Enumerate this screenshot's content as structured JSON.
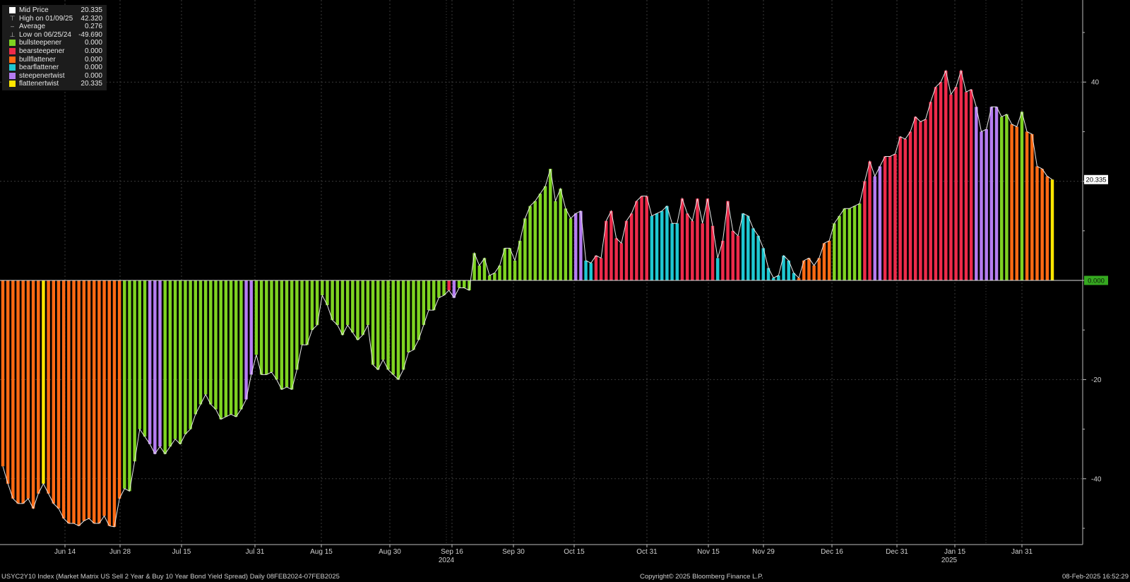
{
  "legend": {
    "rows": [
      {
        "label": "Mid Price",
        "value": "20.335",
        "icon": "white-square-icon",
        "color": "#ffffff"
      },
      {
        "label": "High on 01/09/25",
        "value": "42.320",
        "icon": "high-marker-icon",
        "color": ""
      },
      {
        "label": "Average",
        "value": "0.276",
        "icon": "average-line-icon",
        "color": ""
      },
      {
        "label": "Low on 06/25/24",
        "value": "-49.690",
        "icon": "low-marker-icon",
        "color": ""
      },
      {
        "label": "bullsteepener",
        "value": "0.000",
        "icon": "swatch-icon",
        "color": "#7ed321"
      },
      {
        "label": "bearsteepener",
        "value": "0.000",
        "icon": "swatch-icon",
        "color": "#ee2a4a"
      },
      {
        "label": "bullflattener",
        "value": "0.000",
        "icon": "swatch-icon",
        "color": "#ff6a13"
      },
      {
        "label": "bearflattener",
        "value": "0.000",
        "icon": "swatch-icon",
        "color": "#1ec8d2"
      },
      {
        "label": "steepenertwist",
        "value": "0.000",
        "icon": "swatch-icon",
        "color": "#b57cf2"
      },
      {
        "label": "flattenertwist",
        "value": "20.335",
        "icon": "swatch-icon",
        "color": "#ffe600"
      }
    ]
  },
  "footer": {
    "description": "USYC2Y10 Index (Market Matrix US Sell 2 Year & Buy 10 Year Bond Yield Spread)  Daily 08FEB2024-07FEB2025",
    "copyright": "Copyright© 2025 Bloomberg Finance L.P.",
    "timestamp": "08-Feb-2025 16:52:29"
  },
  "chart_data": {
    "type": "bar",
    "ylim": [
      -50,
      50
    ],
    "yticks": [
      "40",
      "20",
      "-20",
      "-40"
    ],
    "last_value_label": "20.335",
    "zero_label": "0.000",
    "zero_label_color": "#35a820",
    "grid": true,
    "legend_position": "top-left",
    "xtick_labels": [
      "Jun 14",
      "Jun 28",
      "Jul 15",
      "Jul 31",
      "Aug 15",
      "Aug 30",
      "Sep 16",
      "Sep 30",
      "Oct 15",
      "Oct 31",
      "Nov 15",
      "Nov 29",
      "Dec 16",
      "Dec 31",
      "Jan 15",
      "Jan 31"
    ],
    "year_labels": [
      {
        "label": "2024",
        "below": "Sep 16"
      },
      {
        "label": "2025",
        "below": "Jan 15"
      }
    ],
    "regime_colors": {
      "bullsteepener": "#7ed321",
      "bearsteepener": "#ee2a4a",
      "bullflattener": "#ff6a13",
      "bearflattener": "#1ec8d2",
      "steepenertwist": "#b57cf2",
      "flattenertwist": "#ffe600"
    },
    "series": [
      {
        "name": "Mid Price",
        "regime_key": [
          "bullsteepener",
          "bearsteepener",
          "bullflattener",
          "bearflattener",
          "steepenertwist",
          "flattenertwist"
        ],
        "points": [
          [
            -37.5,
            2
          ],
          [
            -41.0,
            2
          ],
          [
            -44.0,
            2
          ],
          [
            -45.0,
            2
          ],
          [
            -45.0,
            2
          ],
          [
            -44.0,
            2
          ],
          [
            -46.0,
            2
          ],
          [
            -43.0,
            2
          ],
          [
            -41.0,
            5
          ],
          [
            -43.0,
            2
          ],
          [
            -45.0,
            2
          ],
          [
            -46.0,
            2
          ],
          [
            -48.0,
            2
          ],
          [
            -49.0,
            2
          ],
          [
            -49.0,
            2
          ],
          [
            -49.5,
            2
          ],
          [
            -48.5,
            2
          ],
          [
            -48.0,
            2
          ],
          [
            -49.0,
            2
          ],
          [
            -49.0,
            2
          ],
          [
            -47.5,
            2
          ],
          [
            -49.5,
            2
          ],
          [
            -49.7,
            2
          ],
          [
            -44.0,
            2
          ],
          [
            -42.0,
            0
          ],
          [
            -42.5,
            0
          ],
          [
            -36.5,
            0
          ],
          [
            -30.0,
            0
          ],
          [
            -31.5,
            0
          ],
          [
            -33.0,
            4
          ],
          [
            -35.0,
            4
          ],
          [
            -33.5,
            4
          ],
          [
            -35.0,
            0
          ],
          [
            -33.5,
            0
          ],
          [
            -32.0,
            0
          ],
          [
            -33.0,
            0
          ],
          [
            -31.0,
            0
          ],
          [
            -30.0,
            0
          ],
          [
            -27.0,
            0
          ],
          [
            -25.0,
            0
          ],
          [
            -23.0,
            0
          ],
          [
            -25.0,
            0
          ],
          [
            -26.0,
            0
          ],
          [
            -28.0,
            0
          ],
          [
            -27.5,
            0
          ],
          [
            -27.0,
            0
          ],
          [
            -27.5,
            0
          ],
          [
            -26.0,
            0
          ],
          [
            -24.0,
            4
          ],
          [
            -19.0,
            4
          ],
          [
            -15.0,
            0
          ],
          [
            -19.0,
            0
          ],
          [
            -19.0,
            0
          ],
          [
            -18.5,
            0
          ],
          [
            -20.0,
            0
          ],
          [
            -22.0,
            0
          ],
          [
            -21.5,
            0
          ],
          [
            -22.0,
            0
          ],
          [
            -18.0,
            0
          ],
          [
            -13.0,
            0
          ],
          [
            -13.0,
            0
          ],
          [
            -10.0,
            0
          ],
          [
            -9.0,
            0
          ],
          [
            -3.0,
            0
          ],
          [
            -5.0,
            0
          ],
          [
            -8.0,
            0
          ],
          [
            -9.0,
            0
          ],
          [
            -11.0,
            0
          ],
          [
            -9.0,
            0
          ],
          [
            -10.5,
            0
          ],
          [
            -12.0,
            0
          ],
          [
            -11.0,
            0
          ],
          [
            -9.0,
            0
          ],
          [
            -17.0,
            0
          ],
          [
            -18.0,
            0
          ],
          [
            -16.0,
            0
          ],
          [
            -18.0,
            0
          ],
          [
            -19.0,
            0
          ],
          [
            -20.0,
            0
          ],
          [
            -18.0,
            0
          ],
          [
            -14.5,
            0
          ],
          [
            -14.0,
            0
          ],
          [
            -12.0,
            0
          ],
          [
            -9.0,
            0
          ],
          [
            -6.0,
            0
          ],
          [
            -6.0,
            0
          ],
          [
            -3.5,
            0
          ],
          [
            -3.0,
            0
          ],
          [
            -2.0,
            1
          ],
          [
            -3.5,
            4
          ],
          [
            -1.5,
            0
          ],
          [
            -1.5,
            0
          ],
          [
            -2.0,
            0
          ],
          [
            5.5,
            0
          ],
          [
            3.0,
            0
          ],
          [
            4.5,
            0
          ],
          [
            1.0,
            0
          ],
          [
            1.5,
            0
          ],
          [
            3.0,
            0
          ],
          [
            6.5,
            0
          ],
          [
            6.5,
            0
          ],
          [
            4.0,
            0
          ],
          [
            8.0,
            0
          ],
          [
            12.5,
            0
          ],
          [
            15.0,
            0
          ],
          [
            16.0,
            0
          ],
          [
            17.5,
            0
          ],
          [
            19.0,
            0
          ],
          [
            22.5,
            0
          ],
          [
            16.0,
            0
          ],
          [
            18.5,
            0
          ],
          [
            14.5,
            0
          ],
          [
            12.5,
            0
          ],
          [
            13.5,
            4
          ],
          [
            14.0,
            4
          ],
          [
            4.0,
            3
          ],
          [
            3.5,
            3
          ],
          [
            5.0,
            1
          ],
          [
            4.5,
            1
          ],
          [
            12.0,
            1
          ],
          [
            14.0,
            1
          ],
          [
            8.5,
            1
          ],
          [
            7.5,
            1
          ],
          [
            12.0,
            1
          ],
          [
            13.5,
            1
          ],
          [
            16.0,
            1
          ],
          [
            17.0,
            1
          ],
          [
            17.0,
            1
          ],
          [
            13.0,
            3
          ],
          [
            13.5,
            3
          ],
          [
            14.0,
            3
          ],
          [
            15.0,
            3
          ],
          [
            11.5,
            3
          ],
          [
            11.5,
            3
          ],
          [
            16.5,
            1
          ],
          [
            13.5,
            1
          ],
          [
            12.0,
            1
          ],
          [
            16.5,
            1
          ],
          [
            11.5,
            1
          ],
          [
            16.5,
            1
          ],
          [
            11.0,
            1
          ],
          [
            4.5,
            3
          ],
          [
            8.0,
            1
          ],
          [
            16.0,
            1
          ],
          [
            10.0,
            1
          ],
          [
            9.0,
            1
          ],
          [
            13.5,
            3
          ],
          [
            13.0,
            3
          ],
          [
            10.5,
            3
          ],
          [
            9.0,
            3
          ],
          [
            6.5,
            3
          ],
          [
            2.5,
            3
          ],
          [
            0.5,
            3
          ],
          [
            1.0,
            3
          ],
          [
            5.0,
            3
          ],
          [
            4.0,
            3
          ],
          [
            1.5,
            3
          ],
          [
            0.5,
            2
          ],
          [
            4.0,
            2
          ],
          [
            4.5,
            2
          ],
          [
            3.0,
            2
          ],
          [
            4.5,
            2
          ],
          [
            7.5,
            2
          ],
          [
            8.0,
            2
          ],
          [
            11.5,
            0
          ],
          [
            13.0,
            0
          ],
          [
            14.5,
            0
          ],
          [
            14.5,
            0
          ],
          [
            15.0,
            0
          ],
          [
            15.5,
            0
          ],
          [
            20.0,
            1
          ],
          [
            24.0,
            1
          ],
          [
            21.0,
            4
          ],
          [
            23.0,
            4
          ],
          [
            25.0,
            1
          ],
          [
            25.0,
            1
          ],
          [
            25.5,
            1
          ],
          [
            29.0,
            1
          ],
          [
            28.5,
            1
          ],
          [
            30.0,
            1
          ],
          [
            33.0,
            1
          ],
          [
            32.0,
            1
          ],
          [
            32.5,
            1
          ],
          [
            36.0,
            1
          ],
          [
            39.0,
            1
          ],
          [
            40.0,
            1
          ],
          [
            42.3,
            1
          ],
          [
            37.5,
            1
          ],
          [
            39.0,
            1
          ],
          [
            42.3,
            1
          ],
          [
            38.0,
            1
          ],
          [
            38.5,
            1
          ],
          [
            35.0,
            4
          ],
          [
            30.0,
            4
          ],
          [
            30.5,
            4
          ],
          [
            35.0,
            4
          ],
          [
            35.0,
            4
          ],
          [
            33.0,
            0
          ],
          [
            33.5,
            0
          ],
          [
            31.5,
            2
          ],
          [
            31.0,
            2
          ],
          [
            34.0,
            0
          ],
          [
            30.0,
            2
          ],
          [
            29.5,
            2
          ],
          [
            23.0,
            2
          ],
          [
            22.5,
            2
          ],
          [
            21.0,
            2
          ],
          [
            20.335,
            5
          ]
        ]
      }
    ]
  }
}
